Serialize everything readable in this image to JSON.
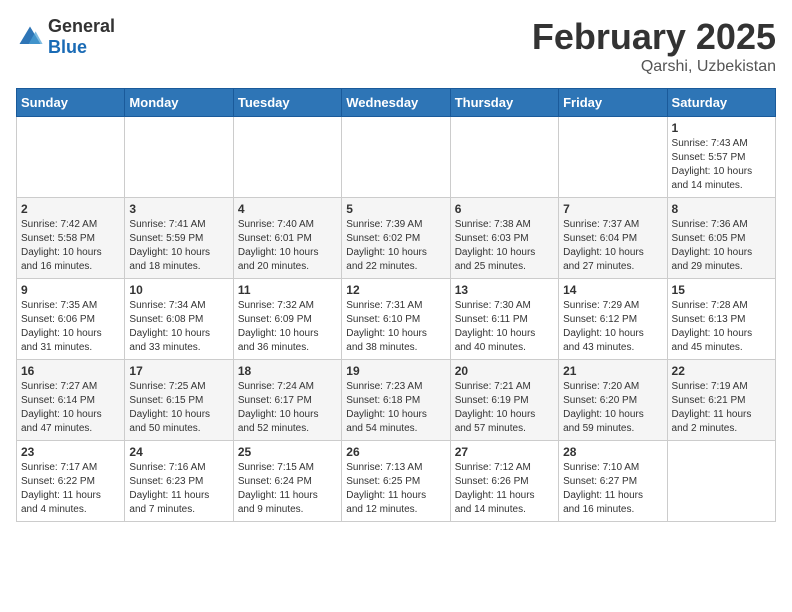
{
  "header": {
    "logo": {
      "general": "General",
      "blue": "Blue"
    },
    "title": "February 2025",
    "location": "Qarshi, Uzbekistan"
  },
  "weekdays": [
    "Sunday",
    "Monday",
    "Tuesday",
    "Wednesday",
    "Thursday",
    "Friday",
    "Saturday"
  ],
  "weeks": [
    [
      {
        "day": "",
        "info": ""
      },
      {
        "day": "",
        "info": ""
      },
      {
        "day": "",
        "info": ""
      },
      {
        "day": "",
        "info": ""
      },
      {
        "day": "",
        "info": ""
      },
      {
        "day": "",
        "info": ""
      },
      {
        "day": "1",
        "info": "Sunrise: 7:43 AM\nSunset: 5:57 PM\nDaylight: 10 hours\nand 14 minutes."
      }
    ],
    [
      {
        "day": "2",
        "info": "Sunrise: 7:42 AM\nSunset: 5:58 PM\nDaylight: 10 hours\nand 16 minutes."
      },
      {
        "day": "3",
        "info": "Sunrise: 7:41 AM\nSunset: 5:59 PM\nDaylight: 10 hours\nand 18 minutes."
      },
      {
        "day": "4",
        "info": "Sunrise: 7:40 AM\nSunset: 6:01 PM\nDaylight: 10 hours\nand 20 minutes."
      },
      {
        "day": "5",
        "info": "Sunrise: 7:39 AM\nSunset: 6:02 PM\nDaylight: 10 hours\nand 22 minutes."
      },
      {
        "day": "6",
        "info": "Sunrise: 7:38 AM\nSunset: 6:03 PM\nDaylight: 10 hours\nand 25 minutes."
      },
      {
        "day": "7",
        "info": "Sunrise: 7:37 AM\nSunset: 6:04 PM\nDaylight: 10 hours\nand 27 minutes."
      },
      {
        "day": "8",
        "info": "Sunrise: 7:36 AM\nSunset: 6:05 PM\nDaylight: 10 hours\nand 29 minutes."
      }
    ],
    [
      {
        "day": "9",
        "info": "Sunrise: 7:35 AM\nSunset: 6:06 PM\nDaylight: 10 hours\nand 31 minutes."
      },
      {
        "day": "10",
        "info": "Sunrise: 7:34 AM\nSunset: 6:08 PM\nDaylight: 10 hours\nand 33 minutes."
      },
      {
        "day": "11",
        "info": "Sunrise: 7:32 AM\nSunset: 6:09 PM\nDaylight: 10 hours\nand 36 minutes."
      },
      {
        "day": "12",
        "info": "Sunrise: 7:31 AM\nSunset: 6:10 PM\nDaylight: 10 hours\nand 38 minutes."
      },
      {
        "day": "13",
        "info": "Sunrise: 7:30 AM\nSunset: 6:11 PM\nDaylight: 10 hours\nand 40 minutes."
      },
      {
        "day": "14",
        "info": "Sunrise: 7:29 AM\nSunset: 6:12 PM\nDaylight: 10 hours\nand 43 minutes."
      },
      {
        "day": "15",
        "info": "Sunrise: 7:28 AM\nSunset: 6:13 PM\nDaylight: 10 hours\nand 45 minutes."
      }
    ],
    [
      {
        "day": "16",
        "info": "Sunrise: 7:27 AM\nSunset: 6:14 PM\nDaylight: 10 hours\nand 47 minutes."
      },
      {
        "day": "17",
        "info": "Sunrise: 7:25 AM\nSunset: 6:15 PM\nDaylight: 10 hours\nand 50 minutes."
      },
      {
        "day": "18",
        "info": "Sunrise: 7:24 AM\nSunset: 6:17 PM\nDaylight: 10 hours\nand 52 minutes."
      },
      {
        "day": "19",
        "info": "Sunrise: 7:23 AM\nSunset: 6:18 PM\nDaylight: 10 hours\nand 54 minutes."
      },
      {
        "day": "20",
        "info": "Sunrise: 7:21 AM\nSunset: 6:19 PM\nDaylight: 10 hours\nand 57 minutes."
      },
      {
        "day": "21",
        "info": "Sunrise: 7:20 AM\nSunset: 6:20 PM\nDaylight: 10 hours\nand 59 minutes."
      },
      {
        "day": "22",
        "info": "Sunrise: 7:19 AM\nSunset: 6:21 PM\nDaylight: 11 hours\nand 2 minutes."
      }
    ],
    [
      {
        "day": "23",
        "info": "Sunrise: 7:17 AM\nSunset: 6:22 PM\nDaylight: 11 hours\nand 4 minutes."
      },
      {
        "day": "24",
        "info": "Sunrise: 7:16 AM\nSunset: 6:23 PM\nDaylight: 11 hours\nand 7 minutes."
      },
      {
        "day": "25",
        "info": "Sunrise: 7:15 AM\nSunset: 6:24 PM\nDaylight: 11 hours\nand 9 minutes."
      },
      {
        "day": "26",
        "info": "Sunrise: 7:13 AM\nSunset: 6:25 PM\nDaylight: 11 hours\nand 12 minutes."
      },
      {
        "day": "27",
        "info": "Sunrise: 7:12 AM\nSunset: 6:26 PM\nDaylight: 11 hours\nand 14 minutes."
      },
      {
        "day": "28",
        "info": "Sunrise: 7:10 AM\nSunset: 6:27 PM\nDaylight: 11 hours\nand 16 minutes."
      },
      {
        "day": "",
        "info": ""
      }
    ]
  ]
}
